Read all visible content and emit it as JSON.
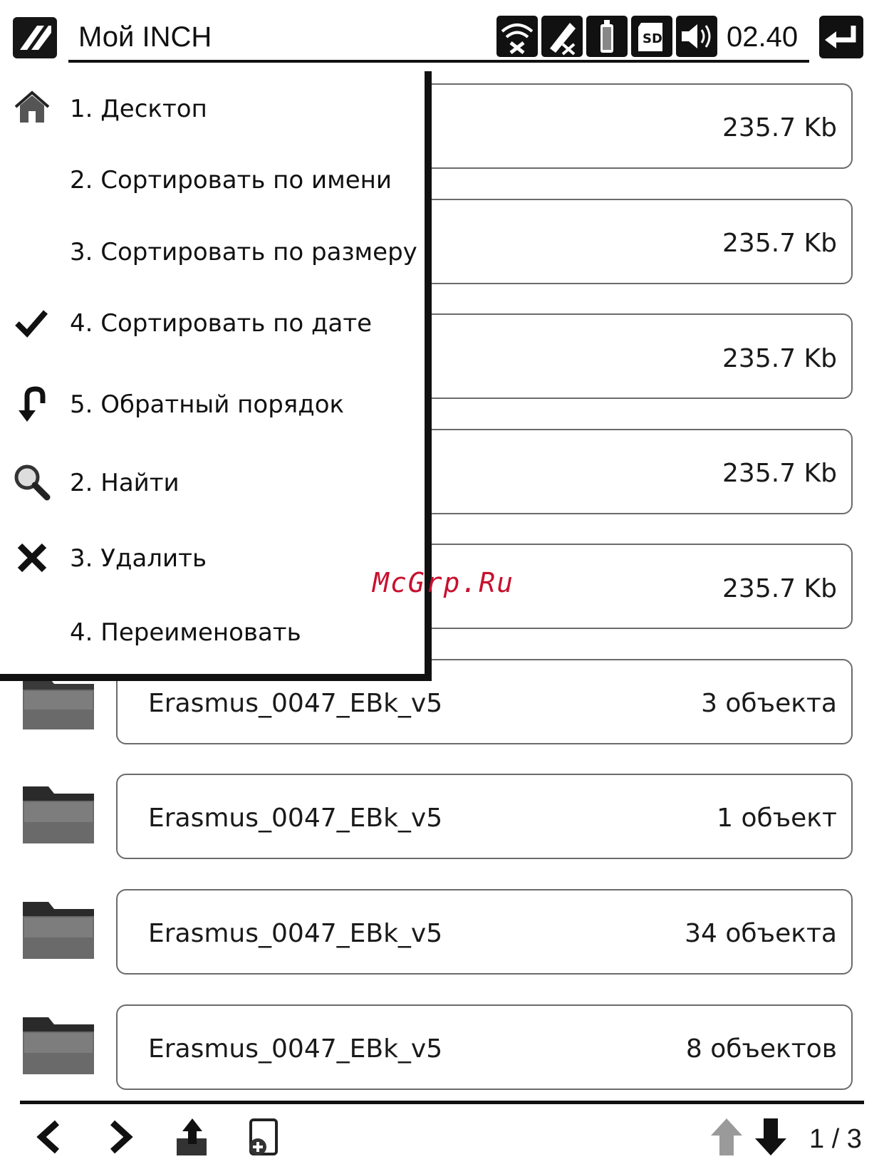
{
  "header": {
    "title": "Мой INCH",
    "time": "02.40",
    "status_icons": [
      "wifi-off-icon",
      "pen-off-icon",
      "battery-icon",
      "sd-card-icon",
      "volume-icon"
    ]
  },
  "menu": {
    "items": [
      {
        "label": "1. Десктоп",
        "icon": "home-icon"
      },
      {
        "label": "2. Сортировать по имени",
        "icon": ""
      },
      {
        "label": "3. Сортировать по размеру",
        "icon": ""
      },
      {
        "label": "4. Сортировать по дате",
        "icon": "checkmark-icon"
      },
      {
        "label": "5. Обратный порядок",
        "icon": "reverse-arrow-icon"
      },
      {
        "label": "2. Найти",
        "icon": "search-icon"
      },
      {
        "label": "3. Удалить",
        "icon": "delete-icon"
      },
      {
        "label": "4. Переименовать",
        "icon": ""
      }
    ]
  },
  "files": [
    {
      "size": "235.7 Kb"
    },
    {
      "size": "235.7 Kb"
    },
    {
      "size": "235.7 Kb"
    },
    {
      "size": "235.7 Kb"
    },
    {
      "size": "235.7 Kb"
    }
  ],
  "folders": [
    {
      "name": "Erasmus_0047_EBk_v5",
      "count": "3 объекта"
    },
    {
      "name": "Erasmus_0047_EBk_v5",
      "count": "1 объект"
    },
    {
      "name": "Erasmus_0047_EBk_v5",
      "count": "34 объекта"
    },
    {
      "name": "Erasmus_0047_EBk_v5",
      "count": "8 объектов"
    }
  ],
  "watermark": "McGrp.Ru",
  "footer": {
    "page": "1 / 3"
  }
}
